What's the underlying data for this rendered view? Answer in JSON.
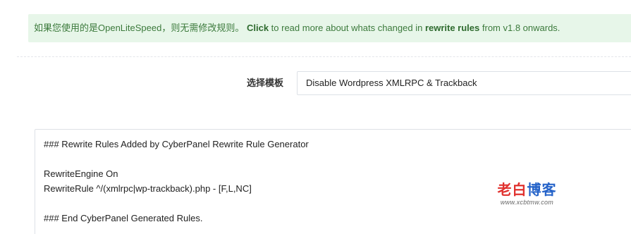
{
  "notice": {
    "prefix": "如果您使用的是OpenLiteSpeed，则无需修改规则。",
    "link_click": "Click",
    "middle": " to read more about whats changed in ",
    "link_rules": "rewrite rules",
    "suffix": " from v1.8 onwards."
  },
  "template": {
    "label": "选择模板",
    "selected": "Disable Wordpress XMLRPC & Trackback"
  },
  "rules": {
    "lines": [
      "### Rewrite Rules Added by CyberPanel Rewrite Rule Generator",
      "",
      "RewriteEngine On",
      "RewriteRule ^/(xmlrpc|wp-trackback).php - [F,L,NC]",
      "",
      "### End CyberPanel Generated Rules."
    ]
  },
  "watermark": {
    "part1": "老白",
    "part2": "博客",
    "url": "www.xcbtmw.com"
  },
  "colors": {
    "notice_bg": "#e7f6e9",
    "notice_text": "#3c7a3c",
    "watermark_red": "#e0312e",
    "watermark_blue": "#2563c9"
  }
}
